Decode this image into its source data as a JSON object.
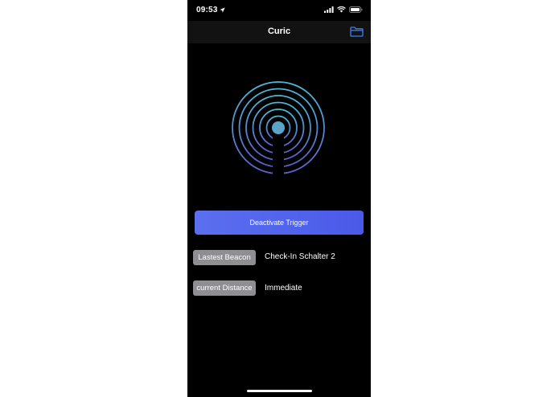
{
  "status_bar": {
    "time": "09:53",
    "icons": [
      "location-arrow-icon",
      "cellular-signal-icon",
      "wifi-icon",
      "battery-icon"
    ]
  },
  "nav": {
    "title": "Curic",
    "right_icon": "folder-icon"
  },
  "graphic": {
    "icon": "beacon-broadcast-icon",
    "gradient_top": "#4fb8d6",
    "gradient_bottom": "#5a5fc8"
  },
  "trigger": {
    "label": "Deactivate Trigger",
    "color": "#5566ee"
  },
  "info": {
    "latest_beacon_label": "Lastest Beacon",
    "latest_beacon_value": "Check-In Schalter 2",
    "distance_label": "current Distance",
    "distance_value": "Immediate"
  },
  "colors": {
    "accent": "#3b82f6",
    "background": "#000000",
    "label_bg": "#8e8e93"
  }
}
